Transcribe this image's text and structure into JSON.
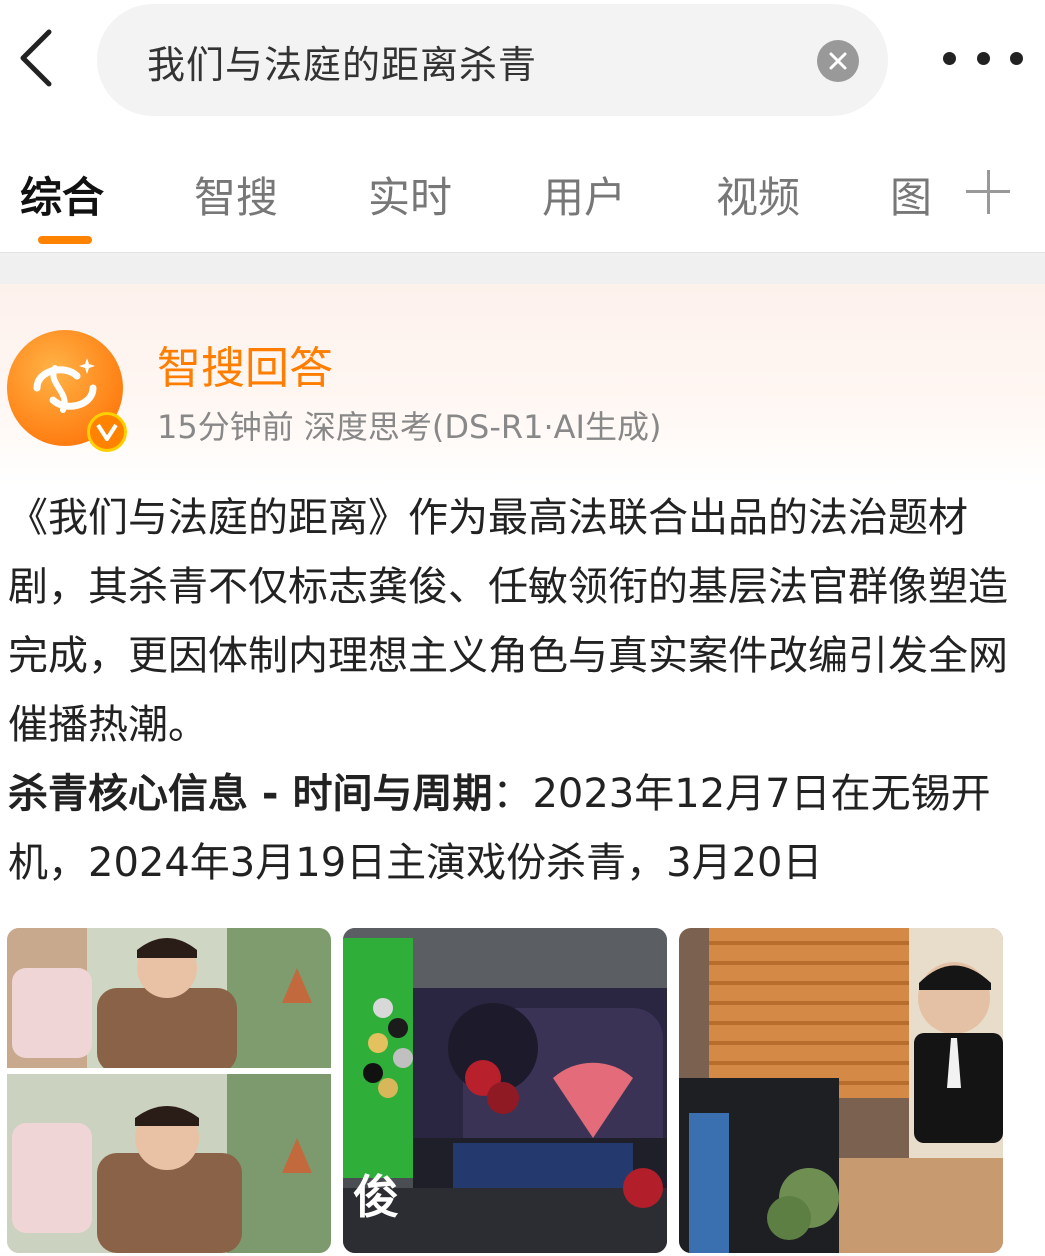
{
  "search": {
    "query": "我们与法庭的距离杀青"
  },
  "tabs": [
    {
      "label": "综合"
    },
    {
      "label": "智搜"
    },
    {
      "label": "实时"
    },
    {
      "label": "用户"
    },
    {
      "label": "视频"
    },
    {
      "label": "图"
    }
  ],
  "card": {
    "author": "智搜回答",
    "meta": "15分钟前  深度思考(DS-R1·AI生成)",
    "paragraph": "《我们与法庭的距离》作为最高法联合出品的法治题材剧，其杀青不仅标志龚俊、任敏领衔的基层法官群像塑造完成，更因体制内理想主义角色与真实案件改编引发全网催播热潮。",
    "heading": "杀青核心信息 - 时间与周期",
    "heading_rest": "：2023年12月7日在无锡开机，2024年3月19日主演戏份杀青，3月20日",
    "images": [
      {
        "icon": "photo-actor-cafe"
      },
      {
        "icon": "photo-wrap-party-backdrop",
        "overlay_glyph": "俊"
      },
      {
        "icon": "photo-actor-office"
      }
    ]
  },
  "colors": {
    "accent": "#ff8200",
    "author_name": "#ff7d00"
  }
}
